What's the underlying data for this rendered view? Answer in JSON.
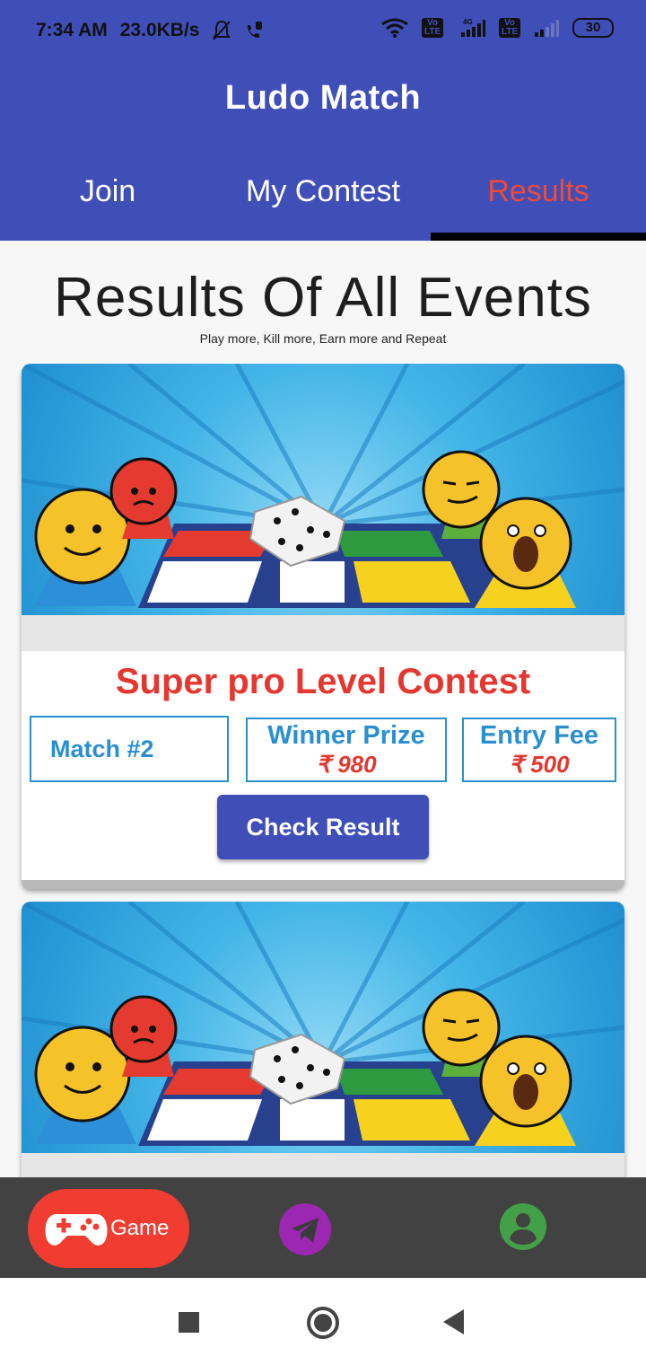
{
  "status_bar": {
    "time": "7:34 AM",
    "speed": "23.0KB/s",
    "battery": "30",
    "network": "4G",
    "volte_1": "Vo LTE",
    "volte_2": "Vo LTE"
  },
  "app": {
    "title": "Ludo Match",
    "tabs": [
      {
        "label": "Join"
      },
      {
        "label": "My Contest"
      },
      {
        "label": "Results"
      }
    ],
    "active_tab": "Results",
    "accent": "#3f4fb7",
    "active_color": "#ef4a3b"
  },
  "page": {
    "heading": "Results Of All Events",
    "subheading": "Play more, Kill more, Earn more and Repeat"
  },
  "cards": [
    {
      "contest_title": "Super pro Level Contest",
      "match": "Match #2",
      "prize_label": "Winner Prize",
      "prize_value": "₹ 980",
      "fee_label": "Entry Fee",
      "fee_value": "₹ 500",
      "button_label": "Check Result"
    }
  ],
  "bottom_nav": {
    "game_label": "Game",
    "icons": [
      "gamepad-icon",
      "telegram-icon",
      "account-icon"
    ]
  },
  "system_nav": {
    "icons": [
      "recents-icon",
      "home-icon",
      "back-icon"
    ]
  }
}
